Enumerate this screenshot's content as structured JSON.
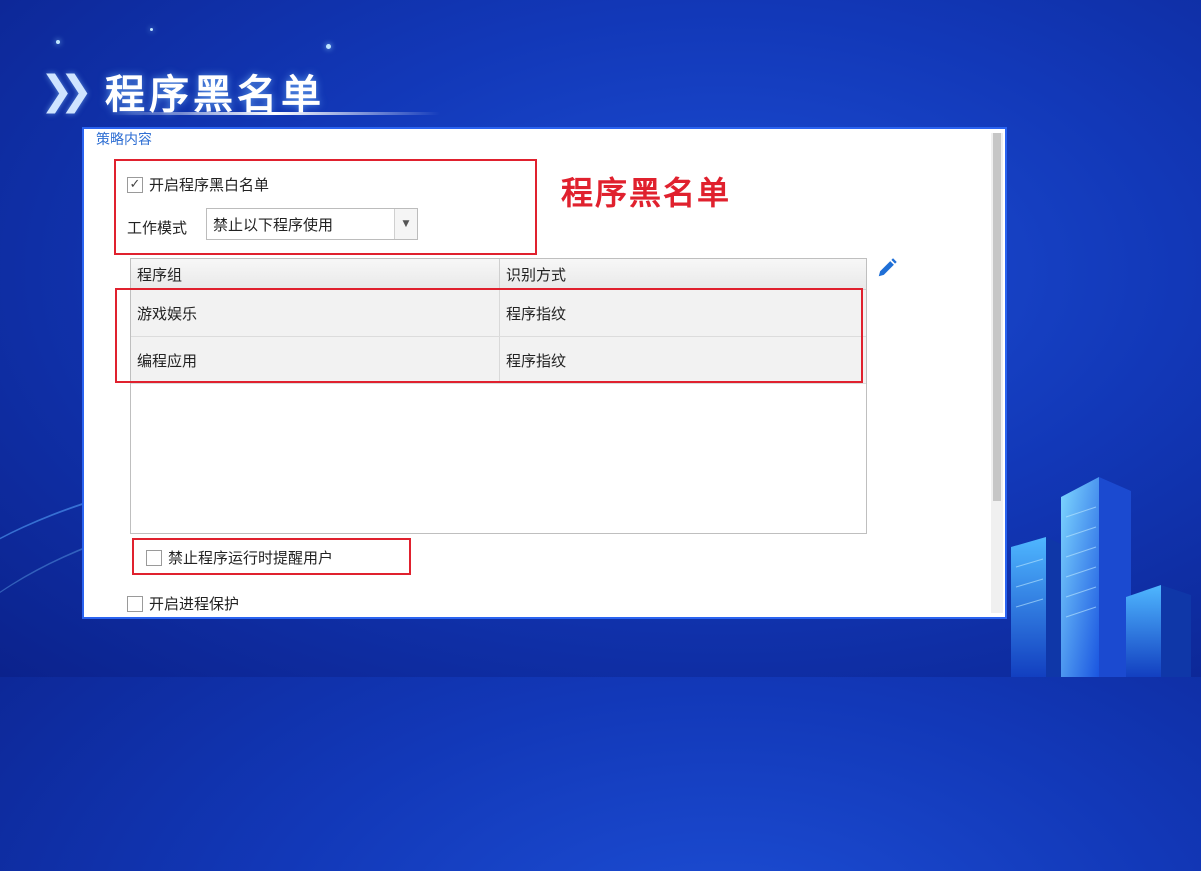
{
  "slide": {
    "title": "程序黑名单",
    "chevrons": "❯❯"
  },
  "panel": {
    "section_title": "策略内容",
    "enable_blacklist": {
      "label": "开启程序黑白名单",
      "checked": true
    },
    "work_mode": {
      "label": "工作模式",
      "value": "禁止以下程序使用"
    },
    "table": {
      "headers": [
        "程序组",
        "识别方式"
      ],
      "rows": [
        [
          "游戏娱乐",
          "程序指纹"
        ],
        [
          "编程应用",
          "程序指纹"
        ]
      ]
    },
    "notify_user": {
      "label": "禁止程序运行时提醒用户",
      "checked": false
    },
    "process_protect": {
      "label": "开启进程保护",
      "checked": false
    }
  },
  "annotation": {
    "text": "程序黑名单",
    "color": "#e0212e"
  },
  "icons": {
    "edit": "pencil-icon",
    "check": "checkmark-icon",
    "dropdown": "chevron-down-icon"
  }
}
